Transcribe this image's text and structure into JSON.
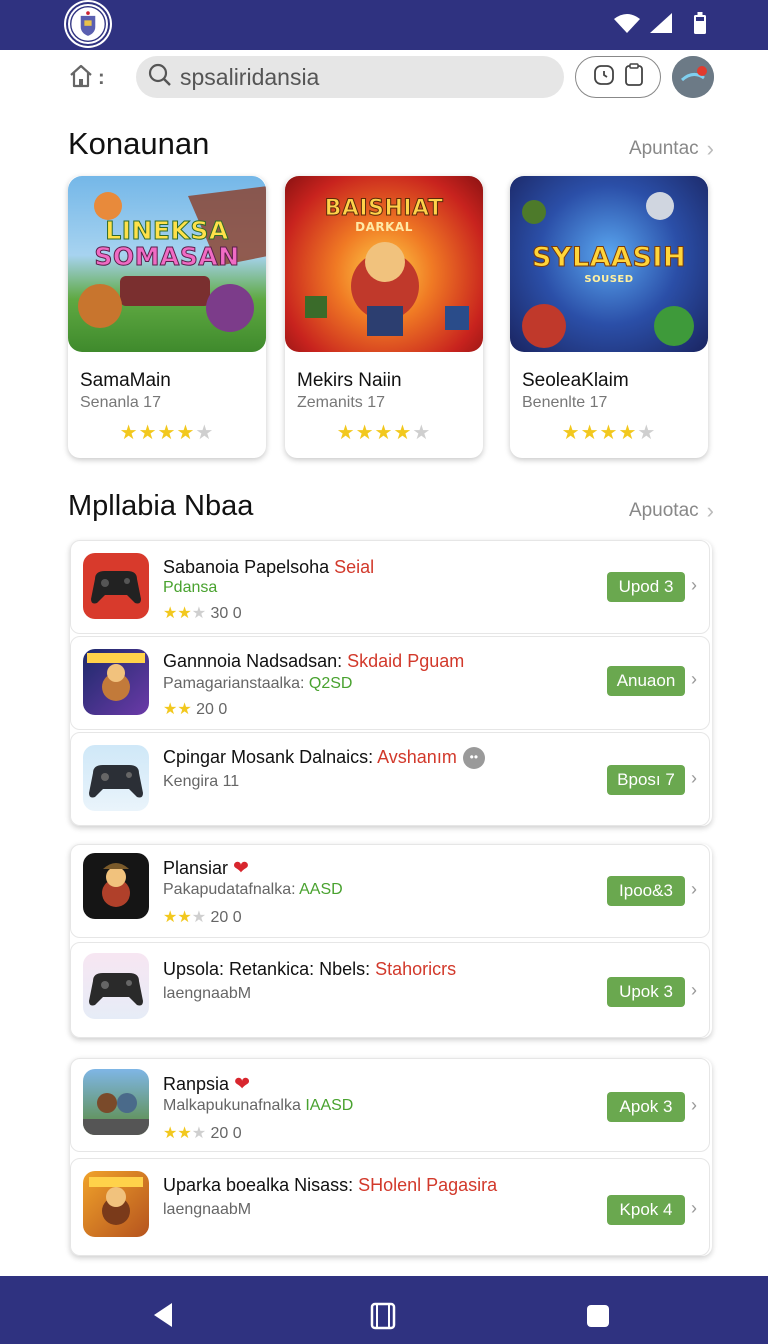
{
  "status_bar": {
    "bg": "#2f3280"
  },
  "search": {
    "query": "spsaliridansia"
  },
  "featured": {
    "title": "Konaunan",
    "see_all": "Apuntac",
    "cards": [
      {
        "art_text": [
          "LINEKSA",
          "SOMASAN"
        ],
        "name": "SamaMain",
        "sub": "Senanla 17",
        "rating": 4
      },
      {
        "art_text": [
          "BAISHIAT",
          "DARKAL"
        ],
        "name": "Mekirs Naiin",
        "sub": "Zemanits 17",
        "rating": 4
      },
      {
        "art_text": [
          "SYLAASIH",
          "SOUSED"
        ],
        "name": "SeoleaKlaim",
        "sub": "Benenlte 17",
        "rating": 4
      }
    ]
  },
  "list": {
    "title": "Mpllabia Nbaa",
    "see_all": "Apuotac",
    "items": [
      {
        "title": "Sabanoia Papelsoha",
        "title_accent": "Seial",
        "line2": "",
        "line2_accent": "Pdansa",
        "line3": "30   0",
        "stars": 2,
        "button": "Upod 3",
        "heart": false,
        "more": false
      },
      {
        "title": "Gannnoia Nadsadsan:",
        "title_accent": "Skdaid Pguam",
        "line2": "Pamagarianstaalka:",
        "line2_accent": "Q2SD",
        "line3": "20   0",
        "stars": 2,
        "button": "Anuaon",
        "heart": false,
        "more": false
      },
      {
        "title": "Cpingar Mosank Dalnaics:",
        "title_accent": "Avshanım",
        "line2": "Kengira  11",
        "line2_accent": "",
        "line3": "",
        "stars": 0,
        "button": "Bposı 7",
        "heart": false,
        "more": true
      },
      {
        "title": "Plansiar",
        "title_accent": "",
        "line2": "Pakapudatafnalka:",
        "line2_accent": "AASD",
        "line3": "20   0",
        "stars": 2,
        "button": "Ipoo&3",
        "heart": true,
        "more": false
      },
      {
        "title": "Upsola: Retankica: Nbels:",
        "title_accent": "Stahoricrs",
        "line2": "laengnaabM",
        "line2_accent": "",
        "line3": "",
        "stars": 0,
        "button": "Upok 3",
        "heart": false,
        "more": false
      },
      {
        "title": "Ranpsia",
        "title_accent": "",
        "line2": "Malkapukunafnalka",
        "line2_accent": "IAASD",
        "line3": "20   0",
        "stars": 2,
        "button": "Apok 3",
        "heart": true,
        "more": false
      },
      {
        "title": "Uparka boealka Nisass:",
        "title_accent": "SHolenl Pagasira",
        "line2": "laengnaabM",
        "line2_accent": "",
        "line3": "",
        "stars": 0,
        "button": "Kpok 4",
        "heart": false,
        "more": false
      }
    ]
  },
  "colors": {
    "brand": "#2f3280",
    "button_green": "#6aa84f",
    "accent_red": "#d2392b",
    "accent_green": "#49a22f",
    "star": "#f2c81e"
  }
}
